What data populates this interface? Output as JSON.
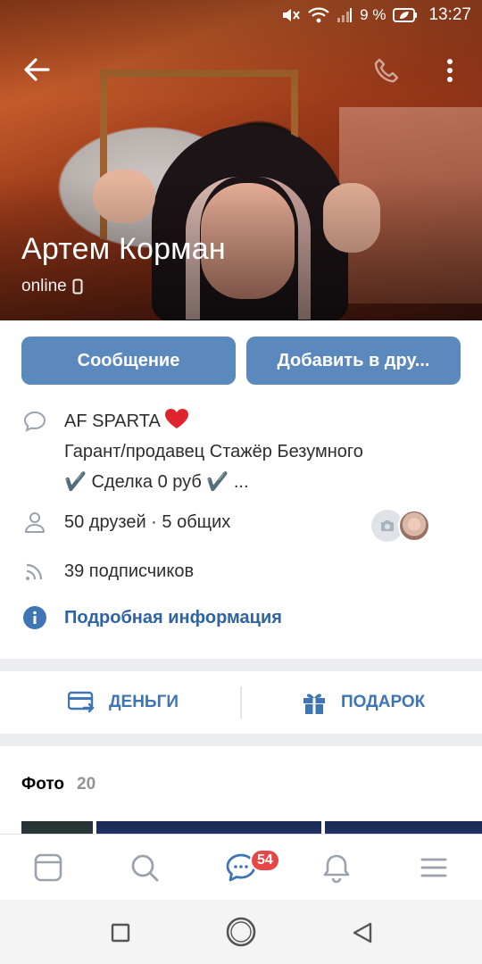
{
  "status_bar": {
    "battery": "9 %",
    "time": "13:27"
  },
  "profile": {
    "name": "Артем Корман",
    "presence": "online"
  },
  "actions": {
    "message_label": "Сообщение",
    "add_friend_label": "Добавить в дру..."
  },
  "info": {
    "status_line1": "AF SPARTA",
    "status_line2": "Гарант/продавец Стажёр Безумного",
    "status_line3": "✔️ Сделка 0 руб ✔️ ...",
    "friends": "50 друзей · 5 общих",
    "followers": "39 подписчиков",
    "details_link": "Подробная информация"
  },
  "quick_actions": {
    "money_label": "ДЕНЬГИ",
    "gift_label": "ПОДАРОК"
  },
  "photos": {
    "title": "Фото",
    "count": "20"
  },
  "tabbar": {
    "messages_badge": "54"
  },
  "colors": {
    "accent": "#5b88bd",
    "link": "#2d64a1",
    "badge": "#e64646",
    "heart": "#e0242e"
  }
}
